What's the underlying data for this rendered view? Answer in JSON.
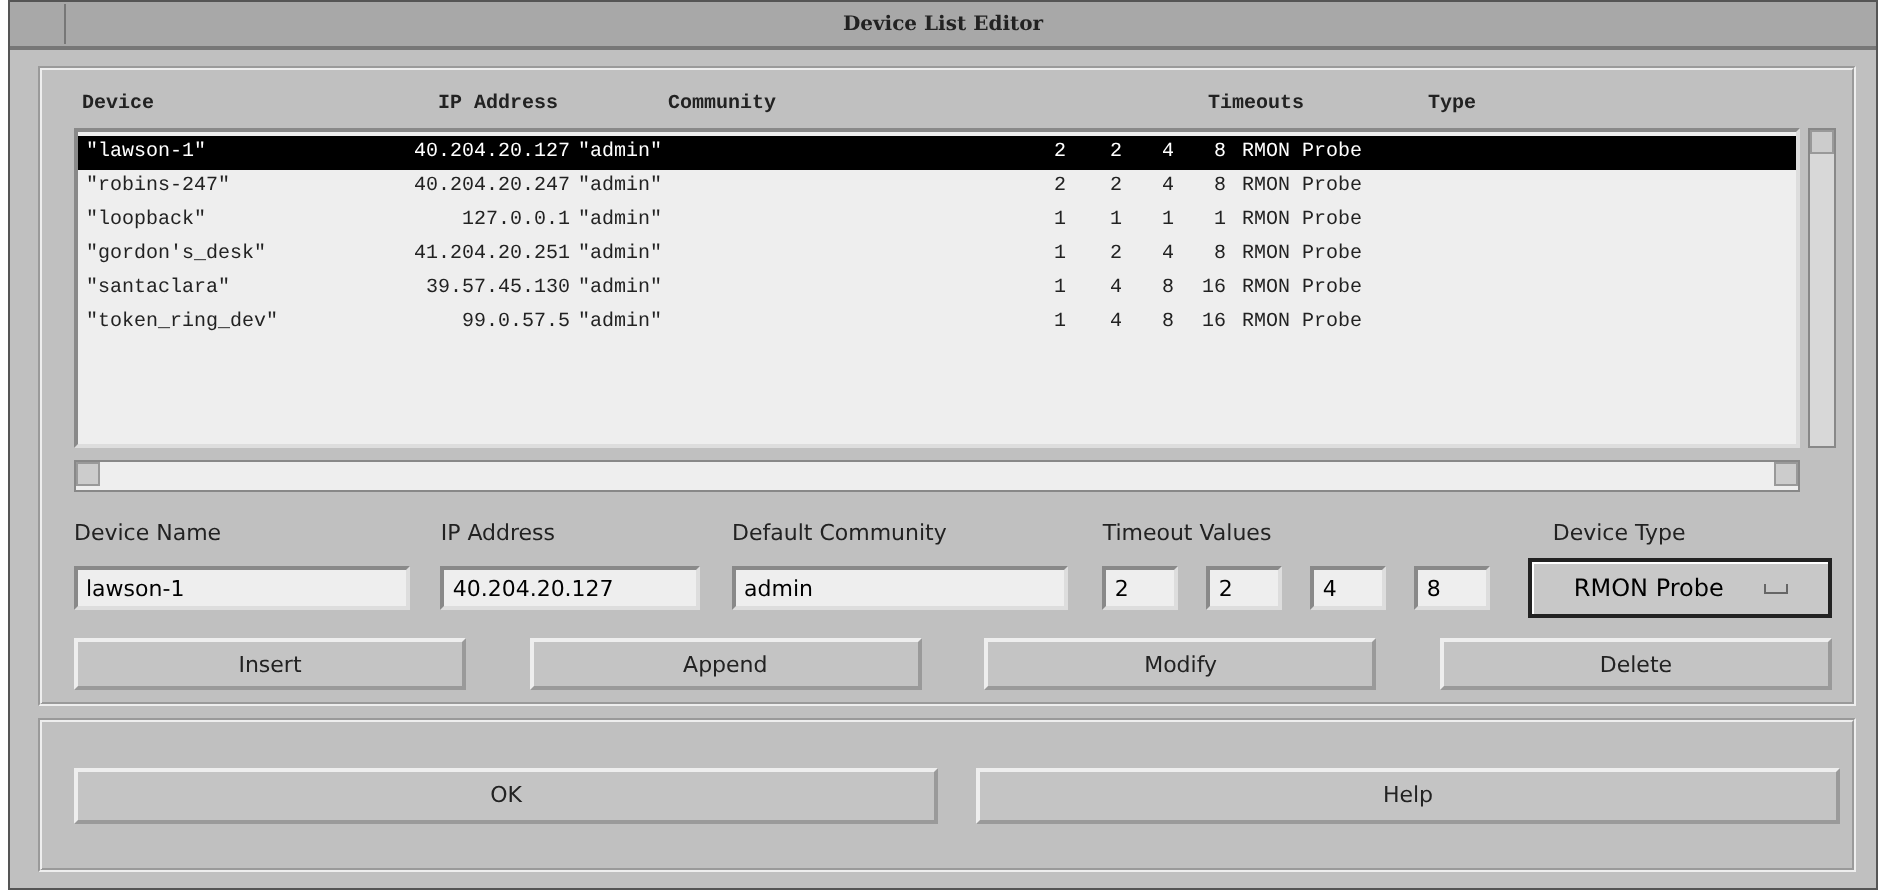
{
  "window": {
    "title": "Device List Editor"
  },
  "list": {
    "columns": [
      "Device",
      "IP Address",
      "Community",
      "Timeouts",
      "Type"
    ],
    "rows": [
      {
        "device": "\"lawson-1\"",
        "ip": "40.204.20.127",
        "community": "\"admin\"",
        "timeouts": [
          "2",
          "2",
          "4",
          "8"
        ],
        "type": "RMON Probe",
        "selected": true
      },
      {
        "device": "\"robins-247\"",
        "ip": "40.204.20.247",
        "community": "\"admin\"",
        "timeouts": [
          "2",
          "2",
          "4",
          "8"
        ],
        "type": "RMON Probe",
        "selected": false
      },
      {
        "device": "\"loopback\"",
        "ip": "127.0.0.1",
        "community": "\"admin\"",
        "timeouts": [
          "1",
          "1",
          "1",
          "1"
        ],
        "type": "RMON Probe",
        "selected": false
      },
      {
        "device": "\"gordon's_desk\"",
        "ip": "41.204.20.251",
        "community": "\"admin\"",
        "timeouts": [
          "1",
          "2",
          "4",
          "8"
        ],
        "type": "RMON Probe",
        "selected": false
      },
      {
        "device": "\"santaclara\"",
        "ip": "39.57.45.130",
        "community": "\"admin\"",
        "timeouts": [
          "1",
          "4",
          "8",
          "16"
        ],
        "type": "RMON Probe",
        "selected": false
      },
      {
        "device": "\"token_ring_dev\"",
        "ip": "99.0.57.5",
        "community": "\"admin\"",
        "timeouts": [
          "1",
          "4",
          "8",
          "16"
        ],
        "type": "RMON Probe",
        "selected": false
      }
    ]
  },
  "form": {
    "device_name": {
      "label": "Device Name",
      "value": "lawson-1"
    },
    "ip_address": {
      "label": "IP Address",
      "value": "40.204.20.127"
    },
    "community": {
      "label": "Default Community",
      "value": "admin"
    },
    "timeouts": {
      "label": "Timeout Values",
      "values": [
        "2",
        "2",
        "4",
        "8"
      ]
    },
    "device_type": {
      "label": "Device Type",
      "value": "RMON Probe"
    }
  },
  "actions": [
    "Insert",
    "Append",
    "Modify",
    "Delete"
  ],
  "buttons": [
    "OK",
    "Help"
  ]
}
